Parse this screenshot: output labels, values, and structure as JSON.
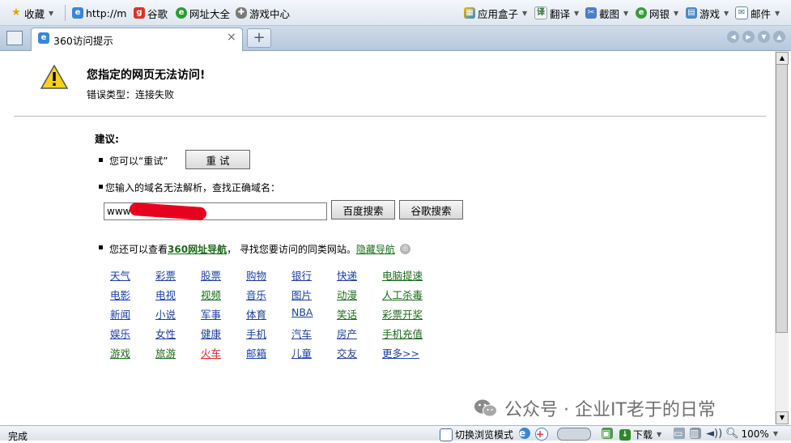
{
  "favorites": {
    "favorites_label": "收藏",
    "addr_label": "http://m",
    "google_label": "谷歌",
    "sites_label": "网址大全",
    "games_center_label": "游戏中心",
    "app_box_label": "应用盒子",
    "translate_label": "翻译",
    "screenshot_label": "截图",
    "bank_label": "网银",
    "games_label": "游戏",
    "mail_label": "邮件"
  },
  "tab": {
    "title": "360访问提示",
    "close": "×",
    "new_tab": "+"
  },
  "error": {
    "title": "您指定的网页无法访问!",
    "type": "错误类型：连接失败"
  },
  "suggestions": {
    "title": "建议:",
    "retry_text": "您可以“重试”",
    "retry_button": "重 试",
    "domain_text": "您输入的域名无法解析，查找正确域名：",
    "url_value": "www",
    "baidu_button": "百度搜索",
    "google_button": "谷歌搜索",
    "nav_prefix": "您还可以查看",
    "nav_link": "360网址导航",
    "nav_suffix": "， 寻找您要访问的同类网站。",
    "hide_link": "隐藏导航"
  },
  "categories": [
    [
      "天气",
      "彩票",
      "股票",
      "购物",
      "银行",
      "快递",
      "电脑提速"
    ],
    [
      "电影",
      "电视",
      "视频",
      "音乐",
      "图片",
      "动漫",
      "人工杀毒"
    ],
    [
      "新闻",
      "小说",
      "军事",
      "体育",
      "NBA",
      "笑话",
      "彩票开奖"
    ],
    [
      "娱乐",
      "女性",
      "健康",
      "手机",
      "汽车",
      "房产",
      "手机充值"
    ],
    [
      "游戏",
      "旅游",
      "火车",
      "邮箱",
      "儿童",
      "交友",
      "更多>>"
    ]
  ],
  "colors": {
    "link_blue": "#1a3fa0",
    "link_green": "#1a6a18",
    "link_red": "#e0201a"
  },
  "watermark": "公众号 · 企业IT老于的日常",
  "status": {
    "text": "完成",
    "browse_mode": "切换浏览模式",
    "download": "下载",
    "zoom": "100%"
  }
}
